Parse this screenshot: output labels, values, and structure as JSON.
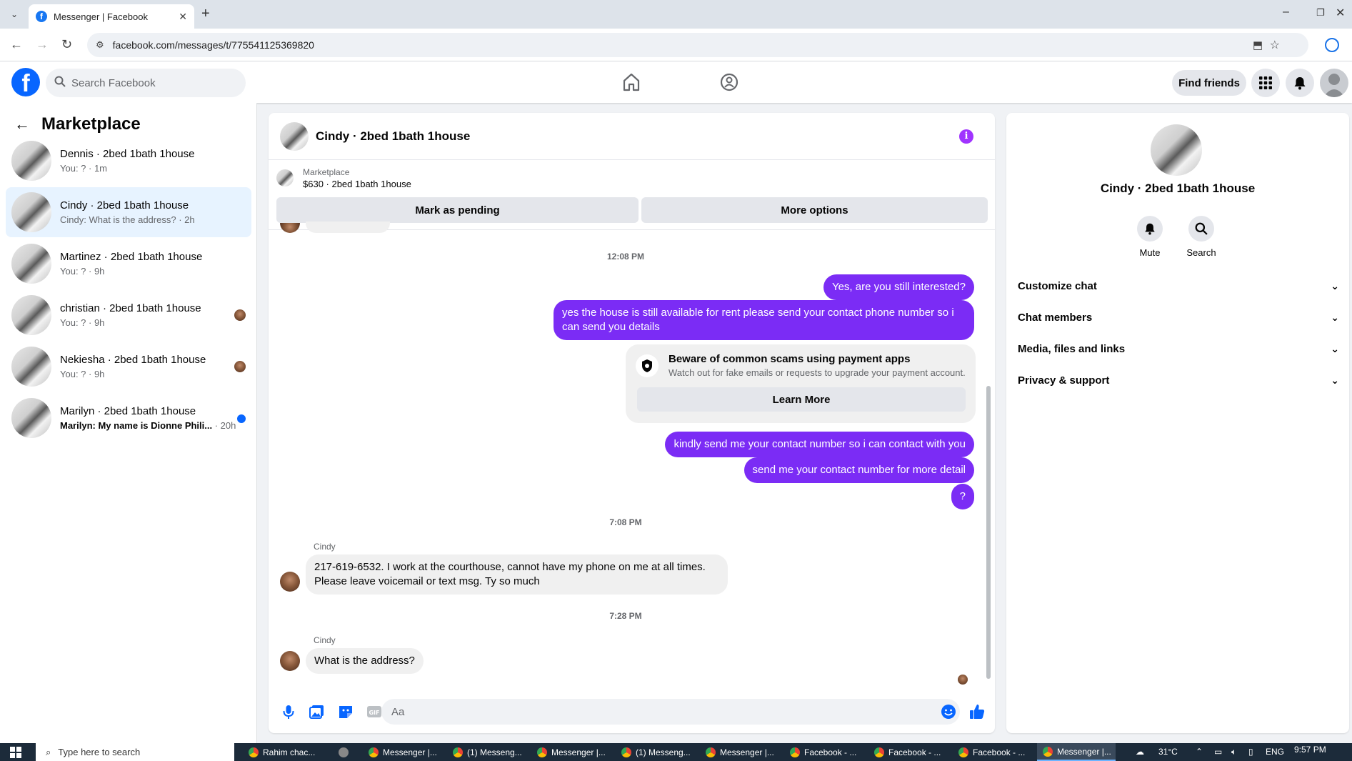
{
  "browser": {
    "tab_title": "Messenger | Facebook",
    "url": "facebook.com/messages/t/775541125369820"
  },
  "fb_header": {
    "search_placeholder": "Search Facebook",
    "find_friends": "Find friends"
  },
  "sidebar": {
    "title": "Marketplace",
    "conversations": [
      {
        "name": "Dennis · 2bed 1bath 1house",
        "preview": "You: ? · 1m"
      },
      {
        "name": "Cindy · 2bed 1bath 1house",
        "preview": "Cindy: What is the address? · 2h"
      },
      {
        "name": "Martinez · 2bed 1bath 1house",
        "preview": "You: ? · 9h"
      },
      {
        "name": "christian · 2bed 1bath 1house",
        "preview": "You: ? · 9h"
      },
      {
        "name": "Nekiesha · 2bed 1bath 1house",
        "preview": "You: ? · 9h"
      },
      {
        "name": "Marilyn · 2bed 1bath 1house",
        "preview": "Marilyn: My name is Dionne Phili...",
        "preview_time": "· 20h"
      }
    ]
  },
  "chat": {
    "title": "Cindy · 2bed 1bath 1house",
    "marketplace_label": "Marketplace",
    "listing": "$630 · 2bed 1bath 1house",
    "mark_pending": "Mark as pending",
    "more_options": "More options",
    "time1": "12:08 PM",
    "out1": "Yes, are you still interested?",
    "out2": "yes the house is still available for rent please send your contact phone number so i can send you details",
    "scam_title": "Beware of common scams using payment apps",
    "scam_text": "Watch out for fake emails or requests to upgrade your payment account.",
    "learn_more": "Learn More",
    "out3": "kindly send me your contact number so i can contact with you",
    "out4": "send me your contact number for more detail",
    "out5": "?",
    "time2": "7:08 PM",
    "sender": "Cindy",
    "in1": "217-619-6532. I work at the  courthouse,  cannot have my phone on me at all times. Please leave voicemail or text msg. Ty so much",
    "time3": "7:28 PM",
    "in2": "What is the address?",
    "composer_placeholder": "Aa"
  },
  "right_panel": {
    "name": "Cindy · 2bed 1bath 1house",
    "mute": "Mute",
    "search": "Search",
    "sections": [
      "Customize chat",
      "Chat members",
      "Media, files and links",
      "Privacy & support"
    ]
  },
  "taskbar": {
    "search_placeholder": "Type here to search",
    "items": [
      "Rahim chac...",
      "Messenger |...",
      "(1) Messeng...",
      "Messenger |...",
      "(1) Messeng...",
      "Messenger |...",
      "Facebook - ...",
      "Facebook - ...",
      "Facebook - ...",
      "Messenger |..."
    ],
    "weather": "31°C",
    "lang": "ENG",
    "clock": "9:57 PM"
  },
  "colors": {
    "accent": "#0866ff",
    "outgoing_bubble": "#7b2cf5",
    "active_conversation": "#e7f3ff"
  }
}
